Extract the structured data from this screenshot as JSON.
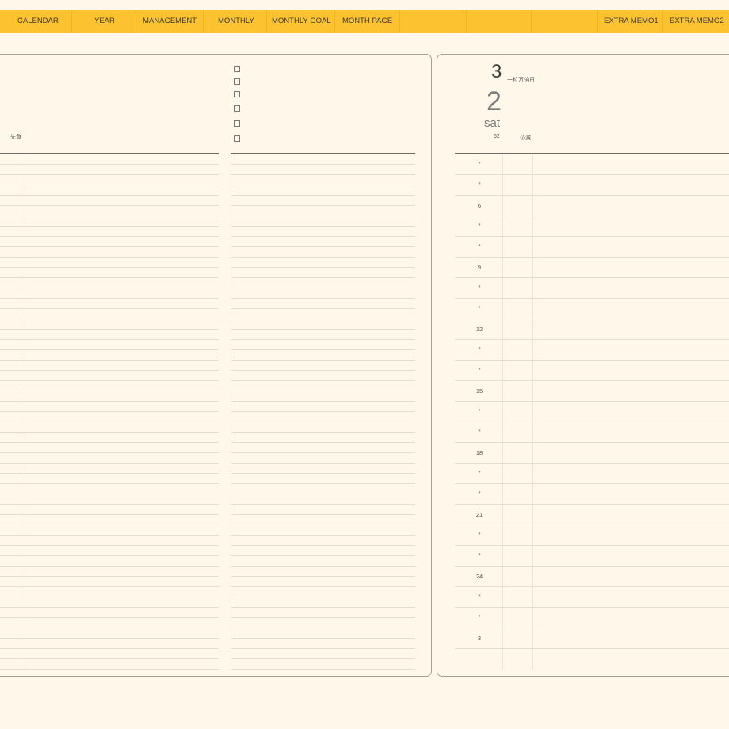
{
  "nav": {
    "tabs": [
      "CALENDAR",
      "YEAR",
      "MANAGEMENT",
      "MONTHLY",
      "MONTHLY GOAL",
      "MONTH PAGE",
      "EXTRA MEMO1",
      "EXTRA MEMO2"
    ]
  },
  "left_page": {
    "label": "先負"
  },
  "right_page": {
    "month": "3",
    "day": "2",
    "weekday": "sat",
    "day_of_year": "62",
    "luck_label": "一粒万倍日",
    "rokuyo": "仏滅",
    "hour_labels": [
      "6",
      "9",
      "12",
      "15",
      "18",
      "21",
      "24",
      "3"
    ],
    "tick_mark": "●"
  },
  "colors": {
    "tab_bar": "#fcc22f",
    "background": "#fff7ea",
    "border": "#a6a099"
  }
}
